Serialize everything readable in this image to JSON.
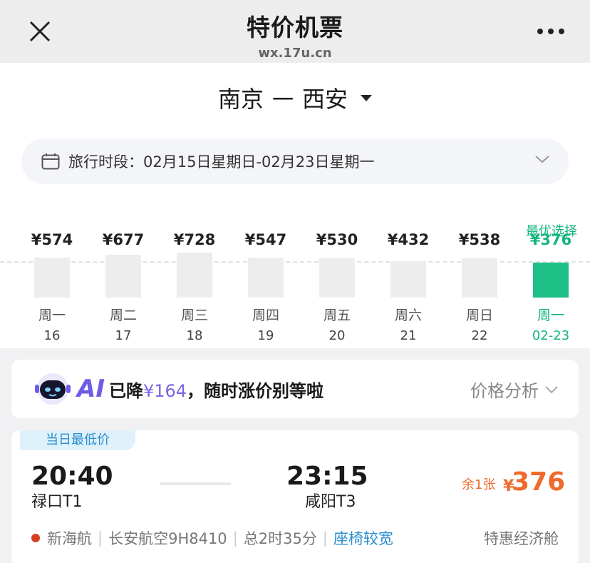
{
  "header": {
    "title": "特价机票",
    "url": "wx.17u.cn"
  },
  "route": {
    "from": "南京",
    "dash": "一",
    "to": "西安"
  },
  "period": {
    "text": "旅行时段：02月15日星期日-02月23日星期一"
  },
  "best_label": "最优选择",
  "days": [
    {
      "price": "¥574",
      "weekday": "周一",
      "date": "16",
      "level": 0.48
    },
    {
      "price": "¥677",
      "weekday": "周二",
      "date": "17",
      "level": 0.52
    },
    {
      "price": "¥728",
      "weekday": "周三",
      "date": "18",
      "level": 0.54
    },
    {
      "price": "¥547",
      "weekday": "周四",
      "date": "19",
      "level": 0.48
    },
    {
      "price": "¥530",
      "weekday": "周五",
      "date": "20",
      "level": 0.47
    },
    {
      "price": "¥432",
      "weekday": "周六",
      "date": "21",
      "level": 0.44
    },
    {
      "price": "¥538",
      "weekday": "周日",
      "date": "22",
      "level": 0.47
    },
    {
      "price": "¥376",
      "weekday": "周一",
      "date": "02-23",
      "level": 0.42,
      "best": true
    }
  ],
  "ai": {
    "logo": "AI",
    "prefix": "已降",
    "amount": "¥164",
    "suffix": "，随时涨价别等啦",
    "analysis": "价格分析"
  },
  "flight": {
    "tag": "当日最低价",
    "dep_time": "20:40",
    "dep_airport": "禄口T1",
    "arr_time": "23:15",
    "arr_airport": "咸阳T3",
    "remain": "余1张",
    "currency": "¥",
    "price": "376",
    "airline": "新海航",
    "flight_no": "长安航空9H8410",
    "duration": "总2时35分",
    "seat_note": "座椅较宽",
    "cabin": "特惠经济舱"
  },
  "colors": {
    "accent_green": "#13b57e",
    "price_orange": "#ef6a2b",
    "ai_purple": "#6e5ce6",
    "link_blue": "#2a8ed0"
  }
}
